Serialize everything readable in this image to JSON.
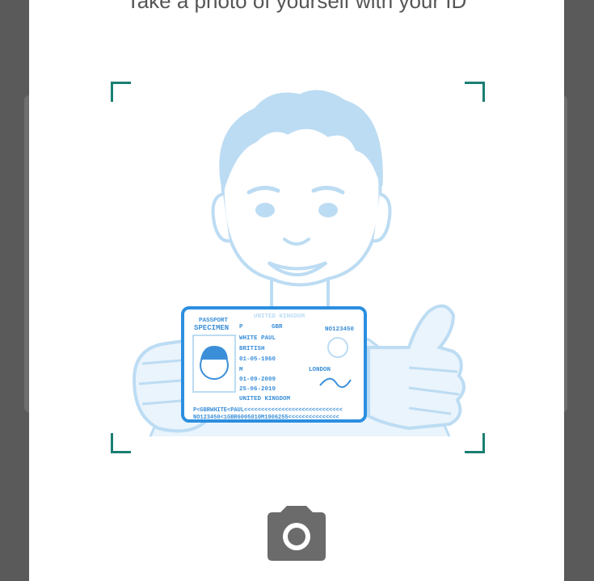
{
  "modal": {
    "cut_title": "Take a photo of yourself with your ID"
  },
  "passport": {
    "header": "PASSPORT",
    "specimen": "SPECIMEN",
    "country": "UNITED KINGDOM",
    "doc_no": "NO123450",
    "type": "P",
    "code": "GBR",
    "name": "WHITE PAUL",
    "nationality": "BRITISH",
    "dob": "01-05-1960",
    "sex": "M",
    "issue_date": "01-09-2009",
    "expiry_date": "25-06-2019",
    "place_of_birth": "LONDON",
    "authority": "UNITED KINGDOM",
    "mrz_line1": "P<GBRWHITE<PAUL<<<<<<<<<<<<<<<<<<<<<<<<<<<<<",
    "mrz_line2": "NO123450<1GBR6005010M1906255<<<<<<<<<<<<<<<"
  },
  "icons": {
    "camera": "camera-icon",
    "corner": "corner-bracket-icon"
  },
  "colors": {
    "illustration": "#bcdcf3",
    "passport_border": "#2c8fe0",
    "brackets": "#1a7f72",
    "camera": "#6b6b6b"
  }
}
